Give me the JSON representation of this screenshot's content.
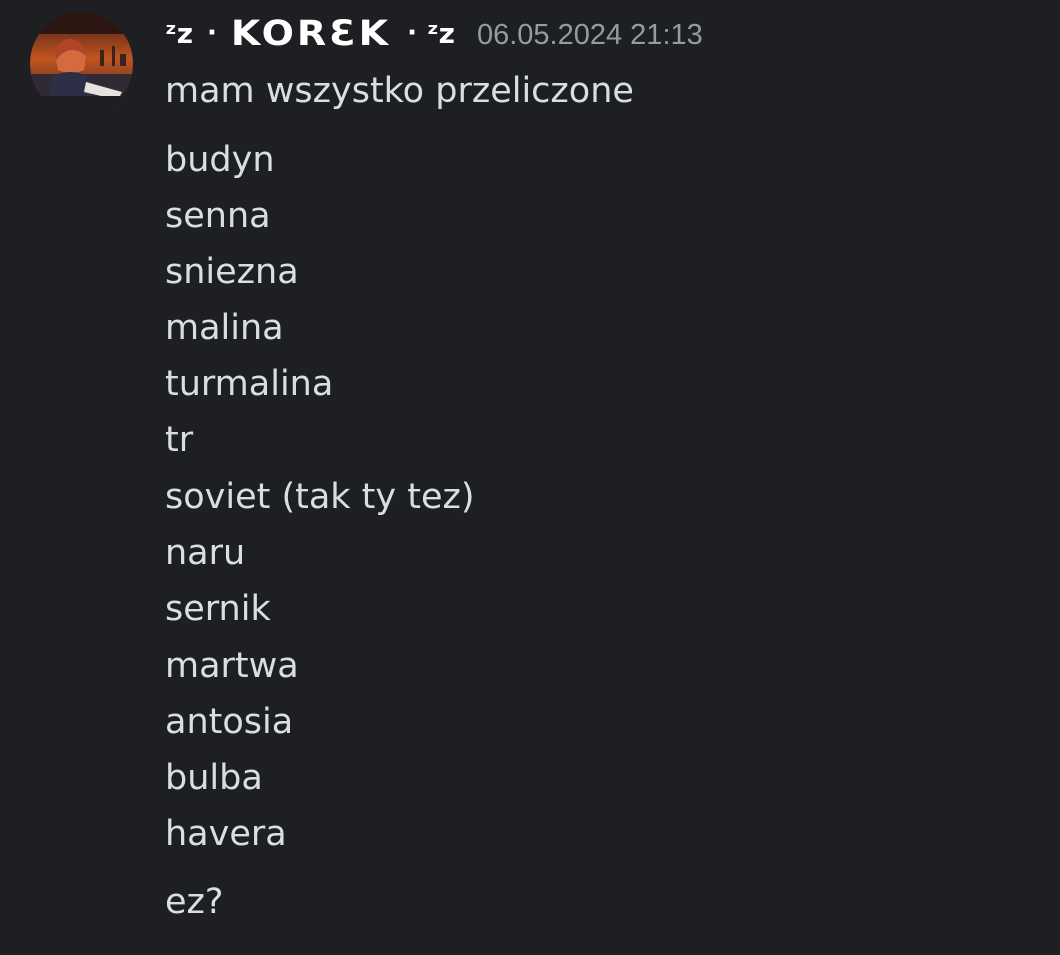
{
  "message": {
    "author": {
      "prefix": "ᶻz",
      "separator": "·",
      "name": "KORƐK",
      "suffix": "ᶻz",
      "avatar_icon": "user-avatar-icon"
    },
    "timestamp": "06.05.2024 21:13",
    "lines": [
      "mam wszystko przeliczone",
      "budyn",
      "senna",
      "sniezna",
      "malina",
      "turmalina",
      "tr",
      "soviet (tak ty tez)",
      "naru",
      "sernik",
      "martwa",
      "antosia",
      "bulba",
      "havera",
      "ez?"
    ]
  },
  "colors": {
    "background": "#1e1f23",
    "text": "#dbdee1",
    "username": "#ffffff",
    "timestamp": "#949ba4"
  }
}
